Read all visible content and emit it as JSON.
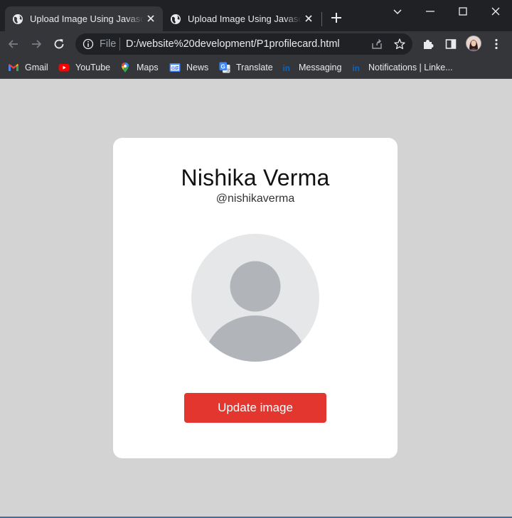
{
  "browser": {
    "tabs": [
      {
        "title": "Upload Image Using Javascript",
        "active": true
      },
      {
        "title": "Upload Image Using Javascript",
        "active": false
      }
    ],
    "address_bar": {
      "scheme_label": "File",
      "url": "D:/website%20development/P1profilecard.html"
    },
    "bookmarks": [
      {
        "label": "Gmail",
        "icon": "gmail-icon"
      },
      {
        "label": "YouTube",
        "icon": "youtube-icon"
      },
      {
        "label": "Maps",
        "icon": "maps-icon"
      },
      {
        "label": "News",
        "icon": "news-icon"
      },
      {
        "label": "Translate",
        "icon": "translate-icon"
      },
      {
        "label": "Messaging",
        "icon": "linkedin-icon"
      },
      {
        "label": "Notifications | Linke...",
        "icon": "linkedin-icon"
      }
    ]
  },
  "profile_card": {
    "name": "Nishika Verma",
    "handle": "@nishikaverma",
    "button_label": "Update image"
  },
  "colors": {
    "page_background": "#d3d3d3",
    "card_background": "#ffffff",
    "button": "#e2362e",
    "avatar_background": "#e5e7e9",
    "avatar_figure": "#b1b5b9",
    "tabbar": "#202124",
    "toolbar": "#35363a"
  }
}
